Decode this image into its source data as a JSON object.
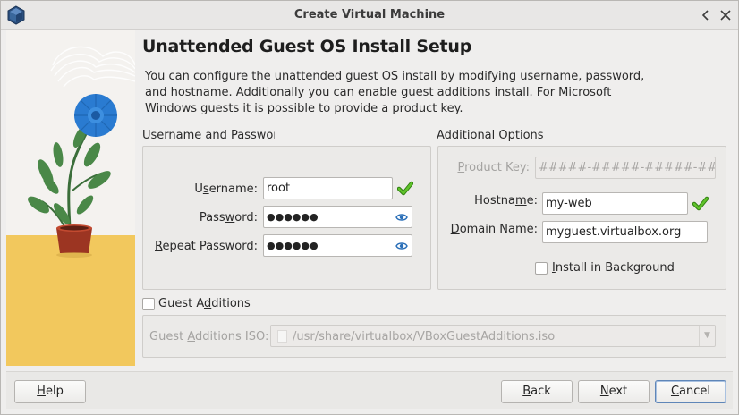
{
  "window": {
    "title": "Create Virtual Machine",
    "minimize_glyph": "‹",
    "close_glyph": "✕"
  },
  "page": {
    "heading": "Unattended Guest OS Install Setup",
    "description": "You can configure the unattended guest OS install by modifying username, password, and hostname. Additionally you can enable guest additions install. For Microsoft Windows guests it is possible to provide a product key."
  },
  "credentials": {
    "group_title": "Username and Passworc",
    "username_label_pre": "U",
    "username_label_acc": "s",
    "username_label_post": "ername:",
    "username_value": "root",
    "password_label_pre": "Pass",
    "password_label_acc": "w",
    "password_label_post": "ord:",
    "password_value": "●●●●●●",
    "repeat_label_acc": "R",
    "repeat_label_post": "epeat Password:",
    "repeat_value": "●●●●●●"
  },
  "additional": {
    "group_title": "Additional Options",
    "product_key_label_pre": "",
    "product_key_label_acc": "P",
    "product_key_label_post": "roduct Key:",
    "product_key_placeholder": "#####-#####-#####-#####-#####",
    "hostname_label_pre": "Hostna",
    "hostname_label_acc": "m",
    "hostname_label_post": "e:",
    "hostname_value": "my-web",
    "domain_label_acc": "D",
    "domain_label_post": "omain Name:",
    "domain_value": "myguest.virtualbox.org",
    "install_bg_acc": "I",
    "install_bg_post": "nstall in Background",
    "install_bg_checked": false
  },
  "guest_additions": {
    "checkbox_pre": "Guest A",
    "checkbox_acc": "d",
    "checkbox_post": "ditions",
    "checked": false,
    "iso_label_pre": "Guest ",
    "iso_label_acc": "A",
    "iso_label_post": "dditions ISO:",
    "iso_path": "/usr/share/virtualbox/VBoxGuestAdditions.iso",
    "dropdown_glyph": "▼"
  },
  "buttons": {
    "help_acc": "H",
    "help_post": "elp",
    "back_acc": "B",
    "back_post": "ack",
    "next_acc": "N",
    "next_post": "ext",
    "cancel_acc": "C",
    "cancel_post": "ancel"
  },
  "colors": {
    "accent_default_button": "#5f86b8",
    "valid_check": "#3ea316",
    "illustration_sand": "#f2c85d",
    "flower_blue": "#2a7bd1",
    "pot": "#9c3522"
  }
}
